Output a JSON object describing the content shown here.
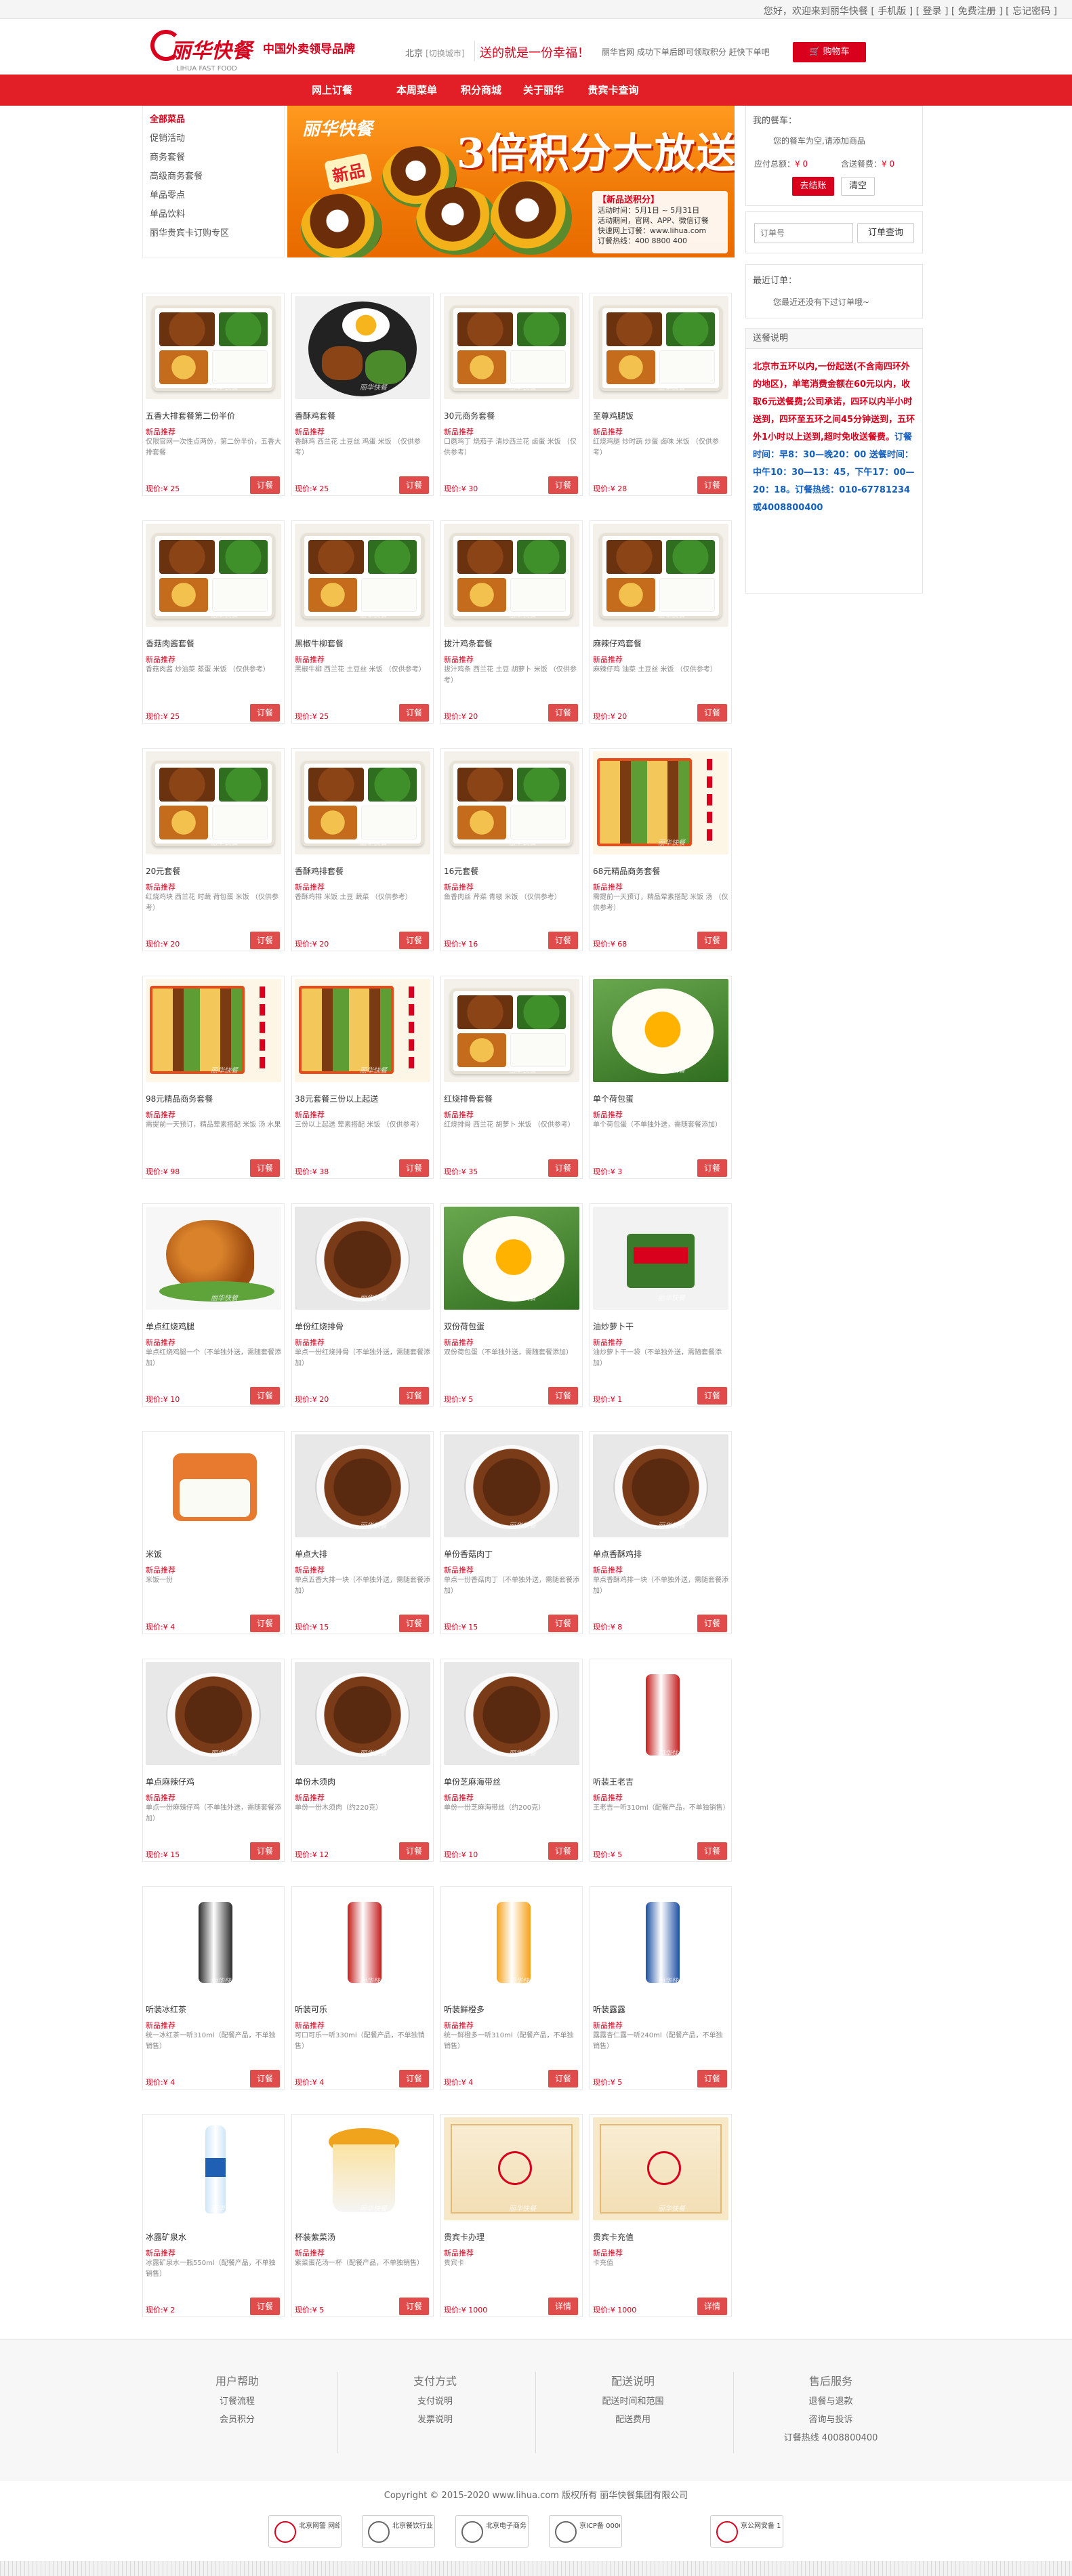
{
  "header": {
    "top_text": "您好，欢迎来到丽华快餐 [ 手机版 ] [ 登录 ] [ 免费注册 ] [ 忘记密码 ]",
    "logo_text": "丽华快餐",
    "logo_sub": "LIHUA FAST FOOD",
    "slogan": "中国外卖领导品牌",
    "city": "北京",
    "city_switch": "[切换城市]",
    "hotline": "送的就是一份幸福！",
    "notice": "丽华官网 成功下单后即可领取积分 赶快下单吧",
    "cart_label": "购物车"
  },
  "nav": [
    "网上订餐",
    "本周菜单",
    "积分商城",
    "关于丽华",
    "贵宾卡查询"
  ],
  "categories": [
    "全部菜品",
    "促销活动",
    "商务套餐",
    "高级商务套餐",
    "单品零点",
    "单品饮料",
    "丽华贵宾卡订购专区"
  ],
  "banner": {
    "logo": "丽华快餐",
    "title": "3倍积分大放送",
    "tag": "新品",
    "info_title": "【新品送积分】",
    "info_lines": [
      "活动时间：5月1日 ~ 5月31日",
      "活动期间，官网、APP、微信订餐",
      "快速网上订餐：www.lihua.com",
      "订餐热线：400 8800 400"
    ]
  },
  "sidebar": {
    "cart_title": "我的餐车：",
    "cart_empty": "您的餐车为空,请添加商品",
    "cart_total_label": "应付总额：",
    "cart_total": "¥ 0",
    "delivery_label": "含送餐费：",
    "delivery": "¥ 0",
    "checkout": "去结账",
    "clear": "清空",
    "query_placeholder": "订单号",
    "query_button": "订单查询",
    "recent_title": "最近订单：",
    "recent_empty": "您最近还没有下过订单哦~",
    "delivery_title": "送餐说明",
    "delivery_red": "北京市五环以内,一份起送(不含南四环外的地区)，单笔消费金额在60元以内，收取6元送餐费;公司承诺，四环以内半小时送到，四环至五环之间45分钟送到，五环外1小时以上送到,超时免收送餐费。",
    "delivery_blue": "订餐时间：早8：30—晚20：00 送餐时间：中午10：30—13：45，下午17：00—20：18。订餐热线：010-67781234或4008800400"
  },
  "products": [
    {
      "name": "五香大排套餐第二份半价",
      "tag": "新品推荐",
      "desc": "仅限官网一次性点两份，第二份半价，五香大排套餐",
      "price": "¥ 25",
      "btn": "订餐"
    },
    {
      "name": "香酥鸡套餐",
      "tag": "新品推荐",
      "desc": "香酥鸡 西兰花 土豆丝 鸡蛋 米饭 （仅供参考）",
      "price": "¥ 25",
      "btn": "订餐"
    },
    {
      "name": "30元商务套餐",
      "tag": "新品推荐",
      "desc": "口蘑鸡丁 烧茄子 清炒西兰花 卤蛋 米饭 （仅供参考）",
      "price": "¥ 30",
      "btn": "订餐"
    },
    {
      "name": "至尊鸡腿饭",
      "tag": "新品推荐",
      "desc": "红烧鸡腿 炒时蔬 炒蛋 卤味 米饭 （仅供参考）",
      "price": "¥ 28",
      "btn": "订餐"
    },
    {
      "name": "香菇肉酱套餐",
      "tag": "新品推荐",
      "desc": "香菇肉酱 炒油菜 蒸蛋 米饭 （仅供参考）",
      "price": "¥ 25",
      "btn": "订餐"
    },
    {
      "name": "黑椒牛柳套餐",
      "tag": "新品推荐",
      "desc": "黑椒牛柳 西兰花 土豆丝 米饭 （仅供参考）",
      "price": "¥ 25",
      "btn": "订餐"
    },
    {
      "name": "拔汁鸡条套餐",
      "tag": "新品推荐",
      "desc": "拔汁鸡条 西兰花 土豆 胡萝卜 米饭 （仅供参考）",
      "price": "¥ 20",
      "btn": "订餐"
    },
    {
      "name": "麻辣仔鸡套餐",
      "tag": "新品推荐",
      "desc": "麻辣仔鸡 油菜 土豆丝 米饭 （仅供参考）",
      "price": "¥ 20",
      "btn": "订餐"
    },
    {
      "name": "20元套餐",
      "tag": "新品推荐",
      "desc": "红烧鸡块 西兰花 时蔬 荷包蛋 米饭 （仅供参考）",
      "price": "¥ 20",
      "btn": "订餐"
    },
    {
      "name": "香酥鸡排套餐",
      "tag": "新品推荐",
      "desc": "香酥鸡排 米饭 土豆 蔬菜 （仅供参考）",
      "price": "¥ 20",
      "btn": "订餐"
    },
    {
      "name": "16元套餐",
      "tag": "新品推荐",
      "desc": "鱼香肉丝 芹菜 青椒 米饭 （仅供参考）",
      "price": "¥ 16",
      "btn": "订餐"
    },
    {
      "name": "68元精品商务套餐",
      "tag": "新品推荐",
      "desc": "需提前一天预订，精品荤素搭配 米饭 汤 （仅供参考）",
      "price": "¥ 68",
      "btn": "订餐"
    },
    {
      "name": "98元精品商务套餐",
      "tag": "新品推荐",
      "desc": "需提前一天预订，精品荤素搭配 米饭 汤 水果",
      "price": "¥ 98",
      "btn": "订餐"
    },
    {
      "name": "38元套餐三份以上起送",
      "tag": "新品推荐",
      "desc": "三份以上起送 荤素搭配 米饭 （仅供参考）",
      "price": "¥ 38",
      "btn": "订餐"
    },
    {
      "name": "红烧排骨套餐",
      "tag": "新品推荐",
      "desc": "红烧排骨 西兰花 胡萝卜 米饭 （仅供参考）",
      "price": "¥ 35",
      "btn": "订餐"
    },
    {
      "name": "单个荷包蛋",
      "tag": "新品推荐",
      "desc": "单个荷包蛋（不单独外送，需随套餐添加）",
      "price": "¥ 3",
      "btn": "订餐"
    },
    {
      "name": "单点红烧鸡腿",
      "tag": "新品推荐",
      "desc": "单点红烧鸡腿一个（不单独外送，需随套餐添加）",
      "price": "¥ 10",
      "btn": "订餐"
    },
    {
      "name": "单份红烧排骨",
      "tag": "新品推荐",
      "desc": "单点一份红烧排骨（不单独外送，需随套餐添加）",
      "price": "¥ 20",
      "btn": "订餐"
    },
    {
      "name": "双份荷包蛋",
      "tag": "新品推荐",
      "desc": "双份荷包蛋（不单独外送，需随套餐添加）",
      "price": "¥ 5",
      "btn": "订餐"
    },
    {
      "name": "油炒萝卜干",
      "tag": "新品推荐",
      "desc": "油炒萝卜干一袋（不单独外送，需随套餐添加）",
      "price": "¥ 1",
      "btn": "订餐"
    },
    {
      "name": "米饭",
      "tag": "新品推荐",
      "desc": "米饭一份",
      "price": "¥ 4",
      "btn": "订餐"
    },
    {
      "name": "单点大排",
      "tag": "新品推荐",
      "desc": "单点五香大排一块（不单独外送，需随套餐添加）",
      "price": "¥ 15",
      "btn": "订餐"
    },
    {
      "name": "单份香菇肉丁",
      "tag": "新品推荐",
      "desc": "单点一份香菇肉丁（不单独外送，需随套餐添加）",
      "price": "¥ 15",
      "btn": "订餐"
    },
    {
      "name": "单点香酥鸡排",
      "tag": "新品推荐",
      "desc": "单点香酥鸡排一块（不单独外送，需随套餐添加）",
      "price": "¥ 8",
      "btn": "订餐"
    },
    {
      "name": "单点麻辣仔鸡",
      "tag": "新品推荐",
      "desc": "单点一份麻辣仔鸡（不单独外送，需随套餐添加）",
      "price": "¥ 15",
      "btn": "订餐"
    },
    {
      "name": "单份木须肉",
      "tag": "新品推荐",
      "desc": "单份一份木须肉（约220克）",
      "price": "¥ 12",
      "btn": "订餐"
    },
    {
      "name": "单份芝麻海带丝",
      "tag": "新品推荐",
      "desc": "单份一份芝麻海带丝（约200克）",
      "price": "¥ 10",
      "btn": "订餐"
    },
    {
      "name": "听装王老吉",
      "tag": "新品推荐",
      "desc": "王老吉一听310ml（配餐产品，不单独销售）",
      "price": "¥ 5",
      "btn": "订餐"
    },
    {
      "name": "听装冰红茶",
      "tag": "新品推荐",
      "desc": "统一冰红茶一听310ml（配餐产品，不单独销售）",
      "price": "¥ 4",
      "btn": "订餐"
    },
    {
      "name": "听装可乐",
      "tag": "新品推荐",
      "desc": "可口可乐一听330ml（配餐产品，不单独销售）",
      "price": "¥ 4",
      "btn": "订餐"
    },
    {
      "name": "听装鲜橙多",
      "tag": "新品推荐",
      "desc": "统一鲜橙多一听310ml（配餐产品，不单独销售）",
      "price": "¥ 4",
      "btn": "订餐"
    },
    {
      "name": "听装露露",
      "tag": "新品推荐",
      "desc": "露露杏仁露一听240ml（配餐产品，不单独销售）",
      "price": "¥ 5",
      "btn": "订餐"
    },
    {
      "name": "冰露矿泉水",
      "tag": "新品推荐",
      "desc": "冰露矿泉水一瓶550ml（配餐产品，不单独销售）",
      "price": "¥ 2",
      "btn": "订餐"
    },
    {
      "name": "杯装紫菜汤",
      "tag": "新品推荐",
      "desc": "紫菜蛋花汤一杯（配餐产品，不单独销售）",
      "price": "¥ 5",
      "btn": "订餐"
    },
    {
      "name": "贵宾卡办理",
      "tag": "新品推荐",
      "desc": "贵宾卡",
      "price": "¥ 1000",
      "btn": "详情"
    },
    {
      "name": "贵宾卡充值",
      "tag": "新品推荐",
      "desc": "卡充值",
      "price": "¥ 1000",
      "btn": "详情"
    }
  ],
  "price_label": "现价:",
  "footer": {
    "cols": [
      {
        "title": "用户帮助",
        "links": [
          "订餐流程",
          "会员积分"
        ]
      },
      {
        "title": "支付方式",
        "links": [
          "支付说明",
          "发票说明"
        ]
      },
      {
        "title": "配送说明",
        "links": [
          "配送时间和范围",
          "配送费用"
        ]
      },
      {
        "title": "售后服务",
        "links": [
          "退餐与退款",
          "咨询与投诉",
          "订餐热线 4008800400"
        ]
      }
    ],
    "copyright": "Copyright © 2015-2020 www.lihua.com 版权所有 丽华快餐集团有限公司",
    "badges": [
      "北京网警 网络110",
      "北京餐饮行业协会会员",
      "北京电子商务协会会员",
      "京ICP备 0000000号",
      "京公网安备 11010000000号"
    ]
  }
}
